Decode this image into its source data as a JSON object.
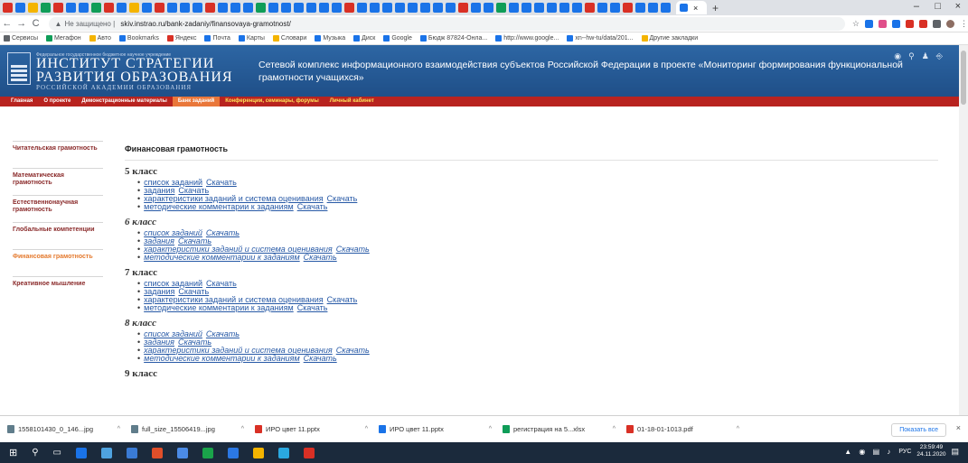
{
  "browser": {
    "address_warning": "Не защищено",
    "url": "skiv.instrao.ru/bank-zadaniy/finansovaya-gramotnost/",
    "tab_colors": [
      "#d93025",
      "#1a73e8",
      "#f4b400",
      "#0f9d58",
      "#d93025",
      "#1a73e8",
      "#1a73e8",
      "#0f9d58",
      "#d93025",
      "#1a73e8",
      "#f4b400",
      "#1a73e8",
      "#d93025",
      "#1a73e8",
      "#1a73e8",
      "#1a73e8",
      "#d93025",
      "#1a73e8",
      "#1a73e8",
      "#1a73e8",
      "#0f9d58",
      "#1a73e8",
      "#1a73e8",
      "#1a73e8",
      "#1a73e8",
      "#1a73e8",
      "#1a73e8",
      "#d93025",
      "#1a73e8",
      "#1a73e8",
      "#1a73e8",
      "#1a73e8",
      "#1a73e8",
      "#1a73e8",
      "#1a73e8",
      "#1a73e8",
      "#d93025",
      "#1a73e8",
      "#1a73e8",
      "#0f9d58",
      "#1a73e8",
      "#1a73e8",
      "#1a73e8",
      "#1a73e8",
      "#1a73e8",
      "#1a73e8",
      "#d93025",
      "#1a73e8",
      "#1a73e8",
      "#d93025",
      "#1a73e8",
      "#1a73e8",
      "#1a73e8"
    ],
    "tab_close": "×",
    "new_tab": "+",
    "win_min": "–",
    "win_max": "□",
    "win_close": "×"
  },
  "bookmarks": [
    {
      "label": "Сервисы",
      "color": "#5f6368"
    },
    {
      "label": "Мегафон",
      "color": "#0f9d58"
    },
    {
      "label": "Авто",
      "color": "#f4b400"
    },
    {
      "label": "Bookmarks",
      "color": "#1a73e8"
    },
    {
      "label": "Яндекс",
      "color": "#d93025"
    },
    {
      "label": "Почта",
      "color": "#1a73e8"
    },
    {
      "label": "Карты",
      "color": "#1a73e8"
    },
    {
      "label": "Словари",
      "color": "#f4b400"
    },
    {
      "label": "Музыка",
      "color": "#1a73e8"
    },
    {
      "label": "Диск",
      "color": "#1a73e8"
    },
    {
      "label": "Google",
      "color": "#1a73e8"
    },
    {
      "label": "Бюдж 87824-Онла...",
      "color": "#1a73e8"
    },
    {
      "label": "http://www.google...",
      "color": "#1a73e8"
    },
    {
      "label": "xn--hw-tu/data/201...",
      "color": "#1a73e8"
    },
    {
      "label": "Другие закладки",
      "color": "#f4b400"
    }
  ],
  "header": {
    "small": "Федеральное государственное бюджетное научное учреждение",
    "line1": "ИНСТИТУТ СТРАТЕГИИ",
    "line2": "РАЗВИТИЯ ОБРАЗОВАНИЯ",
    "line3": "РОССИЙСКОЙ АКАДЕМИИ ОБРАЗОВАНИЯ",
    "tagline": "Сетевой комплекс информационного взаимодействия субъектов Российской Федерации в проекте «Мониторинг формирования функциональной грамотности учащихся»"
  },
  "nav": {
    "items": [
      "Главная",
      "О проекте",
      "Демонстрационные материалы",
      "Банк заданий",
      "Конференции, семинары, форумы",
      "Личный кабинет"
    ]
  },
  "sidebar": {
    "items": [
      "Читательская грамотность",
      "Математическая грамотность",
      "Естественнонаучная грамотность",
      "Глобальные компетенции",
      "Финансовая грамотность",
      "Креативное мышление"
    ]
  },
  "main": {
    "title": "Финансовая грамотность",
    "download_label": "Скачать",
    "link_labels": [
      "список заданий",
      "задания",
      "характеристики заданий и система оценивания",
      "методические комментарии к заданиям"
    ],
    "grades": [
      "5 класс",
      "6 класс",
      "7 класс",
      "8 класс",
      "9 класс"
    ]
  },
  "downloads": [
    {
      "name": "1558101430_0_146...jpg",
      "color": "#607d8b"
    },
    {
      "name": "full_size_15506419...jpg",
      "color": "#607d8b"
    },
    {
      "name": "ИРО цвет 11.pptx",
      "color": "#d93025"
    },
    {
      "name": "ИРО цвет 11.pptx",
      "color": "#1a73e8"
    },
    {
      "name": "регистрация на 5...xlsx",
      "color": "#0f9d58"
    },
    {
      "name": "01-18-01-1013.pdf",
      "color": "#d93025"
    }
  ],
  "downloads_show_all": "Показать все",
  "downloads_close": "×",
  "taskbar": {
    "apps": [
      "#1a73e8",
      "#4fa3e0",
      "#3a7bd5",
      "#e04f2a",
      "#4b8be6",
      "#1aa34a",
      "#2b78e4",
      "#f4b400",
      "#2aa8e0",
      "#d93025"
    ],
    "tray_lang": "РУС",
    "time": "23:59:49",
    "date": "24.11.2020"
  }
}
